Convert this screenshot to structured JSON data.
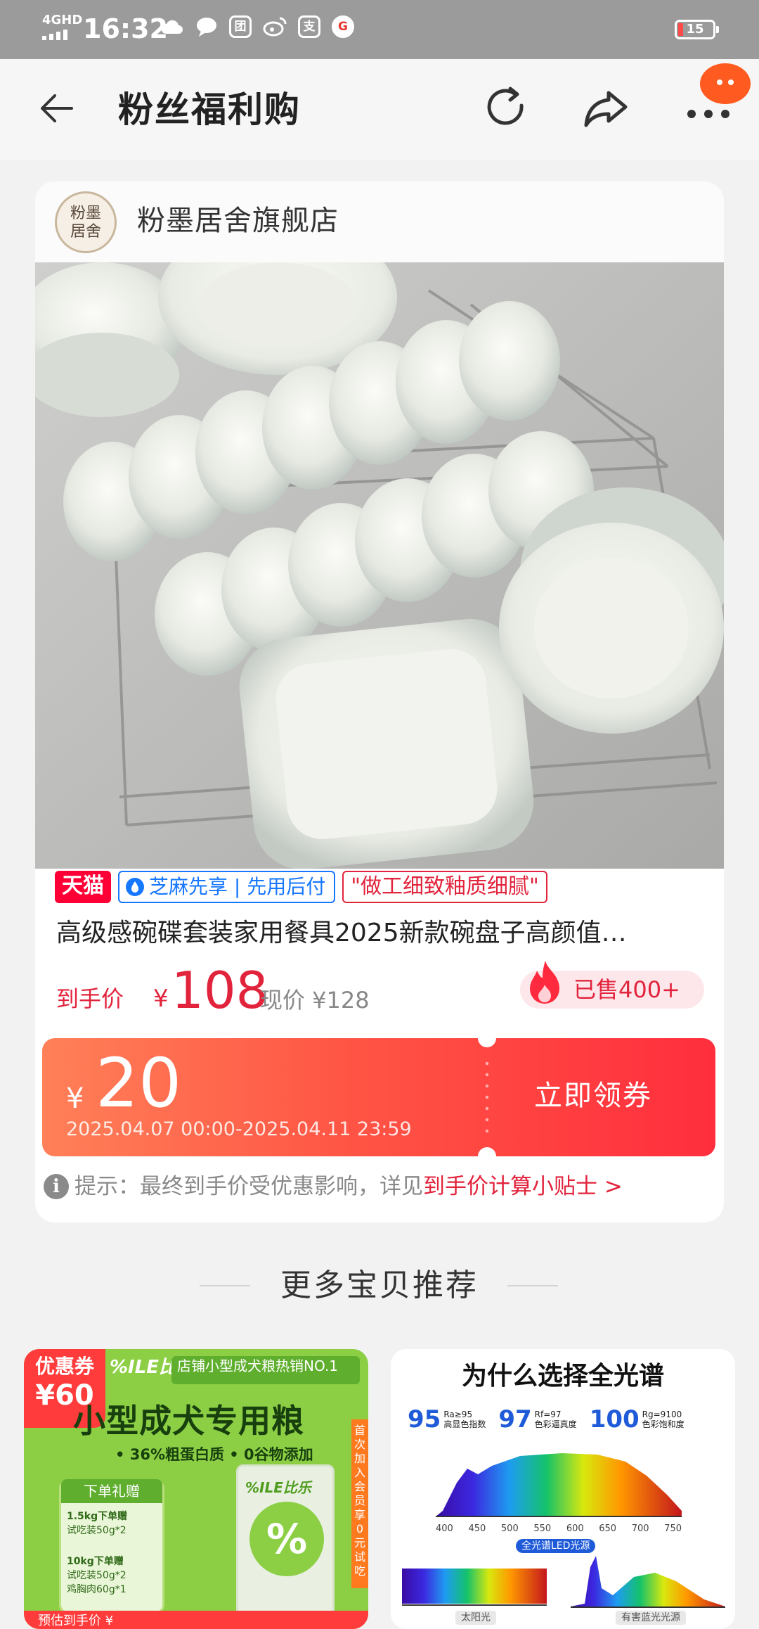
{
  "status_bar": {
    "network": "4GHD",
    "time": "16:32",
    "battery": "15",
    "app_icons": [
      "cloud-icon",
      "chat-bubble-icon",
      "tuan-icon",
      "weibo-icon",
      "alipay-icon",
      "taobao-icon"
    ],
    "tuan_glyph": "团",
    "alipay_glyph": "支",
    "app_glyph": "G"
  },
  "top_bar": {
    "title": "粉丝福利购"
  },
  "store": {
    "logo_line1": "粉墨",
    "logo_line2": "居舍",
    "name": "粉墨居舍旗舰店"
  },
  "product": {
    "tags": {
      "tmall": "天猫",
      "zhima": "芝麻先享 | 先用后付",
      "quote": "\"做工细致釉质细腻\""
    },
    "title": "高级感碗碟套装家用餐具2025新款碗盘子高颜值…",
    "price_label": "到手价",
    "price_currency": "¥",
    "price": "108",
    "original_price": "现价 ¥128",
    "sold": "已售400+"
  },
  "coupon": {
    "currency": "¥",
    "amount": "20",
    "validity": "2025.04.07 00:00-2025.04.11 23:59",
    "button": "立即领券"
  },
  "tip": {
    "icon": "i",
    "text": "提示：最终到手价受优惠影响，详见",
    "link": "到手价计算小贴士 >"
  },
  "section": {
    "title": "更多宝贝推荐"
  },
  "recommend": [
    {
      "badge_line1": "优惠券",
      "badge_line2": "¥60",
      "brand": "%ILE比乐",
      "slogan": "店铺小型成犬粮热销NO.1",
      "title": "小型成犬专用粮",
      "sub": "• 36%粗蛋白质   • 0谷物添加",
      "gift_title": "下单礼赠",
      "gift_line1": "1.5kg下单赠",
      "gift_line2": "试吃装50g*2",
      "gift_line3": "10kg下单赠",
      "gift_line4": "试吃装50g*2",
      "gift_line5": "鸡胸肉60g*1",
      "bag_brand": "%ILE比乐",
      "bag_mark": "%",
      "side_strip": "首次加入会员享0元试吃",
      "footer": "预估到手价 ¥"
    },
    {
      "title": "为什么选择全光谱",
      "metrics": [
        {
          "num": "95",
          "line1": "Ra≥95",
          "line2": "高显色指数"
        },
        {
          "num": "97",
          "line1": "Rf=97",
          "line2": "色彩逼真度"
        },
        {
          "num": "100",
          "line1": "Rg=9100",
          "line2": "色彩饱和度"
        }
      ],
      "axis": [
        "400",
        "450",
        "500",
        "550",
        "600",
        "650",
        "700",
        "750"
      ],
      "spectrum_label": "全光谱LED光源",
      "sun_label": "太阳光",
      "blue_label": "有害蓝光光源"
    }
  ]
}
